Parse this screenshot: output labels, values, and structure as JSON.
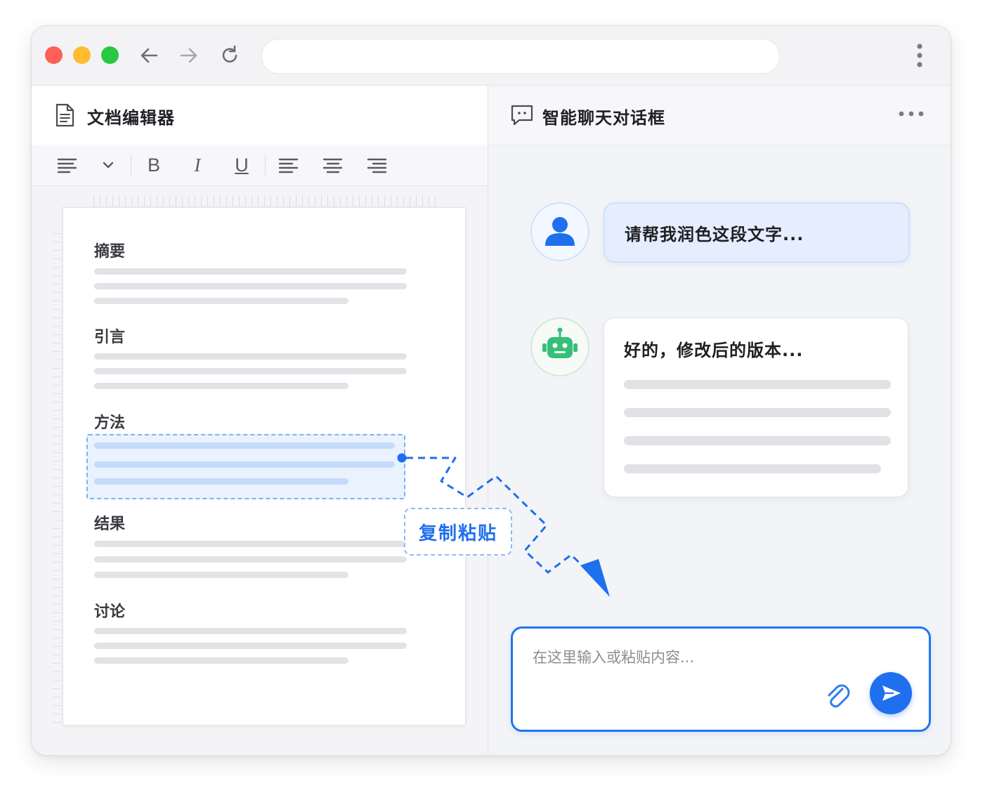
{
  "editor": {
    "title": "文档编辑器",
    "toolbar": {
      "bold": "B",
      "italic": "I",
      "underline": "U"
    },
    "sections": [
      {
        "heading": "摘要"
      },
      {
        "heading": "引言"
      },
      {
        "heading": "方法"
      },
      {
        "heading": "结果"
      },
      {
        "heading": "讨论"
      }
    ]
  },
  "chat": {
    "title": "智能聊天对话框",
    "messages": [
      {
        "role": "user",
        "text": "请帮我润色这段文字..."
      },
      {
        "role": "bot",
        "text": "好的，修改后的版本..."
      }
    ],
    "input": {
      "placeholder": "在这里输入或粘贴内容..."
    }
  },
  "annotation": {
    "label": "复制粘贴"
  },
  "colors": {
    "accent": "#1f6fee",
    "selection": "#eaf2fe",
    "bot": "#34c077"
  }
}
